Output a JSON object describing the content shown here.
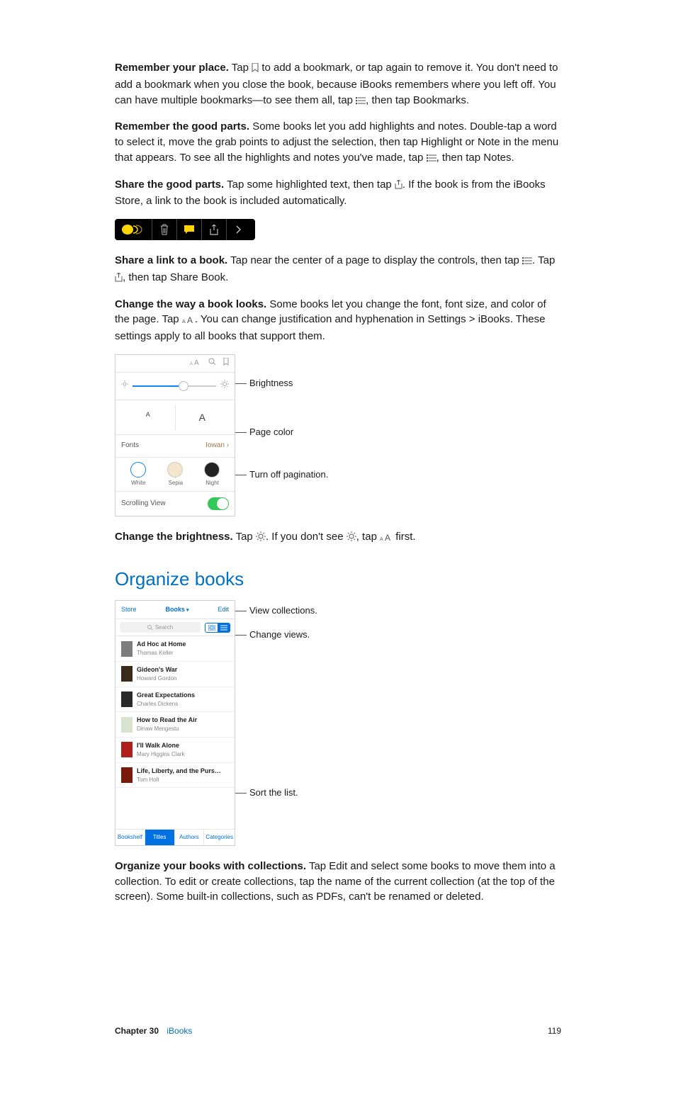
{
  "paragraphs": {
    "p1_bold": "Remember your place.",
    "p1a": " Tap ",
    "p1b": " to add a bookmark, or tap again to remove it. You don't need to add a bookmark when you close the book, because iBooks remembers where you left off. You can have multiple bookmarks—to see them all, tap ",
    "p1c": ", then tap Bookmarks.",
    "p2_bold": "Remember the good parts.",
    "p2a": " Some books let you add highlights and notes. Double-tap a word to select it, move the grab points to adjust the selection, then tap Highlight or Note in the menu that appears. To see all the highlights and notes you've made, tap ",
    "p2b": ", then tap Notes.",
    "p3_bold": "Share the good parts.",
    "p3a": " Tap some highlighted text, then tap ",
    "p3b": ". If the book is from the iBooks Store, a link to the book is included automatically.",
    "p4_bold": "Share a link to a book.",
    "p4a": " Tap near the center of a page to display the controls, then tap ",
    "p4b": ". Tap ",
    "p4c": ", then tap Share Book.",
    "p5_bold": "Change the way a book looks.",
    "p5a": " Some books let you change the font, font size, and color of the page. Tap ",
    "p5b": ". You can change justification and hyphenation in Settings > iBooks. These settings apply to all books that support them.",
    "p6_bold": "Change the brightness.",
    "p6a": " Tap ",
    "p6b": ". If you don't see ",
    "p6c": ", tap ",
    "p6d": " first.",
    "p7_bold": "Organize your books with collections.",
    "p7a": " Tap Edit and select some books to move them into a collection. To edit or create collections, tap the name of the current collection (at the top of the screen). Some built-in collections, such as PDFs, can't be renamed or deleted."
  },
  "section_heading": "Organize books",
  "appearance_panel": {
    "small_a": "A",
    "big_a": "A",
    "fonts_label": "Fonts",
    "fonts_value": "Iowan  ›",
    "swatch_labels": [
      "White",
      "Sepia",
      "Night"
    ],
    "scrolling_label": "Scrolling View"
  },
  "appearance_callouts": {
    "brightness": "Brightness",
    "page_color": "Page color",
    "pagination": "Turn off pagination."
  },
  "library": {
    "top_left": "Store",
    "top_mid": "Books",
    "top_right": "Edit",
    "search_placeholder": "Search",
    "books": [
      {
        "title": "Ad Hoc at Home",
        "author": "Thomas Keller",
        "color": "#7d7d7d"
      },
      {
        "title": "Gideon's War",
        "author": "Howard Gordon",
        "color": "#3a2a1a"
      },
      {
        "title": "Great Expectations",
        "author": "Charles Dickens",
        "color": "#2a2a2a"
      },
      {
        "title": "How to Read the Air",
        "author": "Dinaw Mengestu",
        "color": "#d8e4d0"
      },
      {
        "title": "I'll Walk Alone",
        "author": "Mary Higgins Clark",
        "color": "#b0201a"
      },
      {
        "title": "Life, Liberty, and the Purs…",
        "author": "Tom Holt",
        "color": "#7a1a0a"
      }
    ],
    "tabs": [
      "Bookshelf",
      "Titles",
      "Authors",
      "Categories"
    ],
    "active_tab": 1
  },
  "library_callouts": {
    "collections": "View collections.",
    "views": "Change views.",
    "sort": "Sort the list."
  },
  "footer": {
    "chapter_label": "Chapter  30",
    "chapter_name": "iBooks",
    "page": "119"
  },
  "icons": {
    "bookmark": "bookmark-icon",
    "list": "list-icon",
    "share": "share-icon",
    "aa": "text-size-icon",
    "brightness": "brightness-icon"
  }
}
